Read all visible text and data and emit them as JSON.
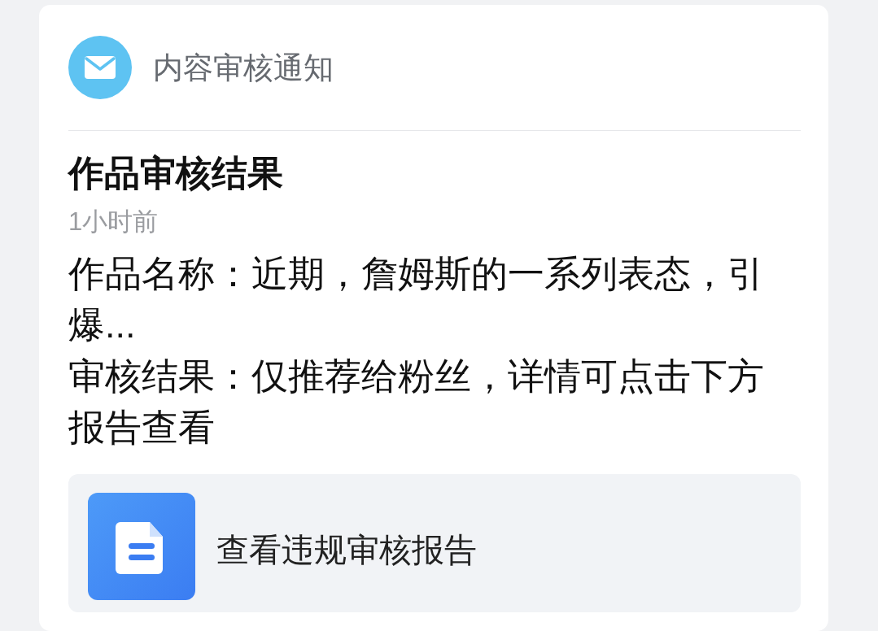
{
  "notification": {
    "source": "内容审核通知",
    "title": "作品审核结果",
    "time": "1小时前",
    "lines": [
      "作品名称：近期，詹姆斯的一系列表态，引爆...",
      "审核结果：仅推荐给粉丝，详情可点击下方报告查看"
    ],
    "report_link": {
      "label": "查看违规审核报告"
    }
  }
}
